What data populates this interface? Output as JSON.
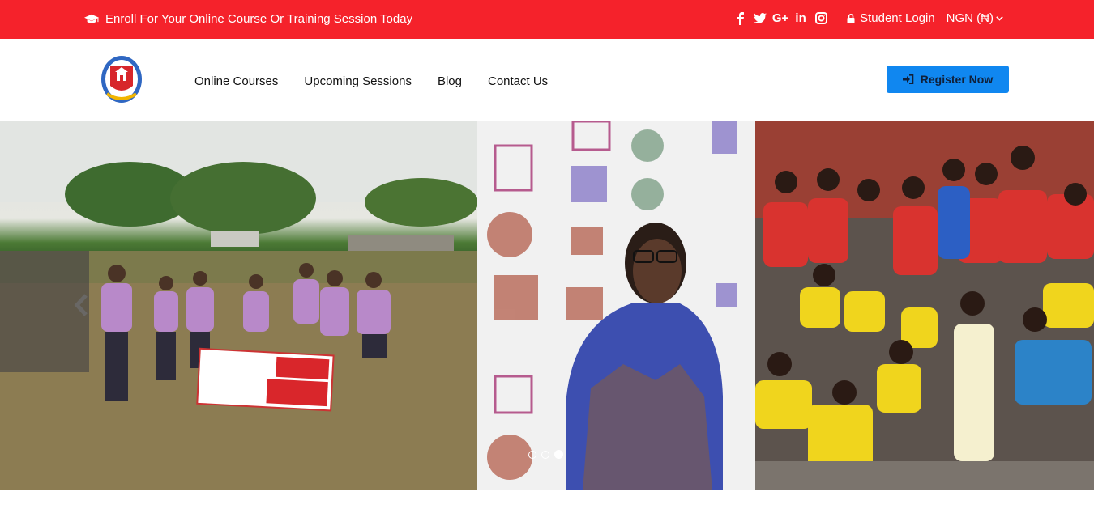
{
  "topbar": {
    "enroll_text": "Enroll For Your Online Course Or Training Session Today",
    "social": [
      {
        "name": "facebook-icon",
        "glyph": "f"
      },
      {
        "name": "twitter-icon",
        "glyph": "t"
      },
      {
        "name": "google-plus-icon",
        "glyph": "G+"
      },
      {
        "name": "linkedin-icon",
        "glyph": "in"
      },
      {
        "name": "instagram-icon",
        "glyph": "ig"
      }
    ],
    "login_label": "Student Login",
    "currency_label": "NGN (₦)"
  },
  "header": {
    "nav": [
      "Online Courses",
      "Upcoming Sessions",
      "Blog",
      "Contact Us"
    ],
    "register_label": "Register Now"
  },
  "hero": {
    "slides": 3,
    "active_slide": 3
  },
  "colors": {
    "topbar": "#f5222b",
    "register": "#1087f0"
  }
}
